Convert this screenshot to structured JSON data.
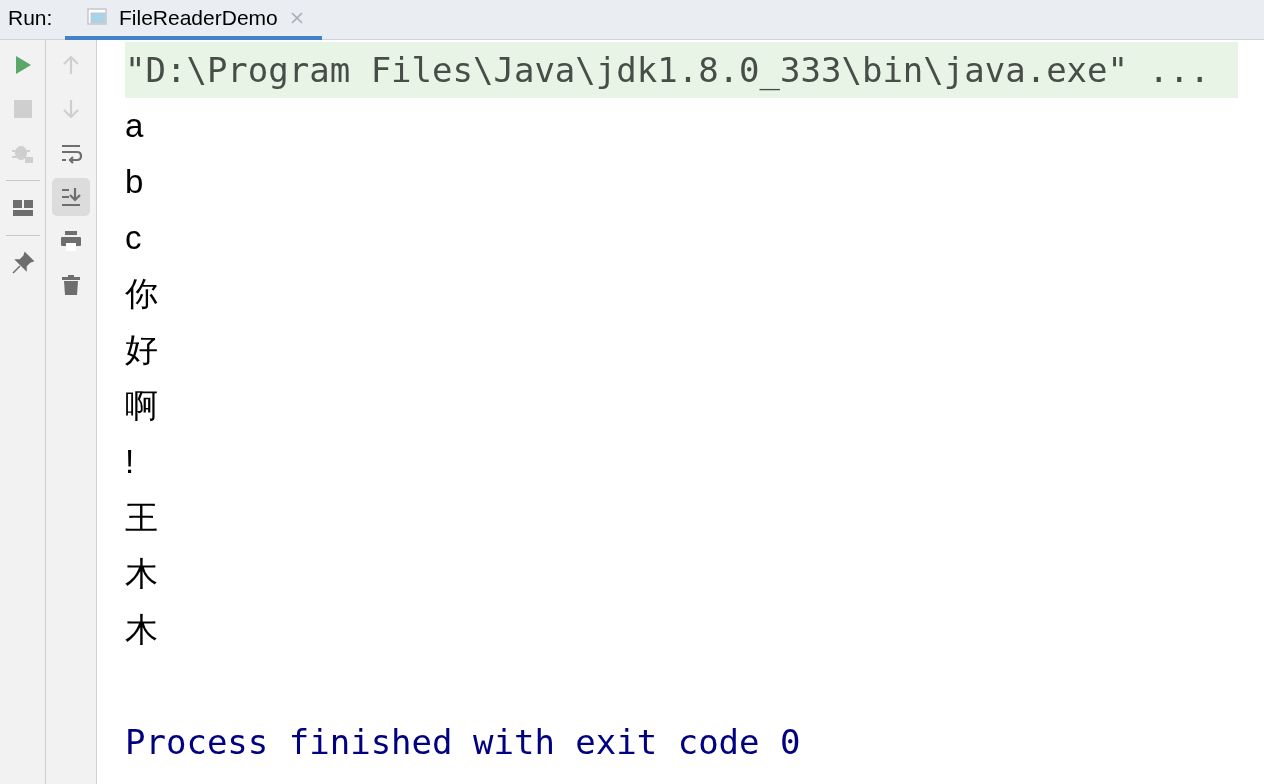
{
  "run_label": "Run:",
  "tabs": [
    {
      "label": "FileReaderDemo",
      "selected": true
    }
  ],
  "left_toolbar": [
    {
      "kind": "run",
      "disabled": false
    },
    {
      "kind": "stop",
      "disabled": true
    },
    {
      "kind": "debug",
      "disabled": true
    },
    {
      "kind": "separator"
    },
    {
      "kind": "layout",
      "disabled": false
    },
    {
      "kind": "separator"
    },
    {
      "kind": "pin",
      "disabled": false
    }
  ],
  "right_toolbar": [
    {
      "kind": "up",
      "disabled": true,
      "selected": false
    },
    {
      "kind": "down",
      "disabled": true,
      "selected": false
    },
    {
      "kind": "wrap",
      "disabled": false,
      "selected": false
    },
    {
      "kind": "scroll_end",
      "disabled": false,
      "selected": true
    },
    {
      "kind": "print",
      "disabled": false,
      "selected": false
    },
    {
      "kind": "trash",
      "disabled": false,
      "selected": false
    }
  ],
  "console": [
    {
      "kind": "command",
      "text": "\"D:\\Program Files\\Java\\jdk1.8.0_333\\bin\\java.exe\" ..."
    },
    {
      "kind": "stdout",
      "text": "a"
    },
    {
      "kind": "stdout",
      "text": "b"
    },
    {
      "kind": "stdout",
      "text": "c"
    },
    {
      "kind": "stdout",
      "text": "你"
    },
    {
      "kind": "stdout",
      "text": "好"
    },
    {
      "kind": "stdout",
      "text": "啊"
    },
    {
      "kind": "stdout",
      "text": "!"
    },
    {
      "kind": "stdout",
      "text": "王"
    },
    {
      "kind": "stdout",
      "text": "木"
    },
    {
      "kind": "stdout",
      "text": "木"
    },
    {
      "kind": "blank"
    },
    {
      "kind": "system",
      "text": "Process finished with exit code 0"
    }
  ]
}
